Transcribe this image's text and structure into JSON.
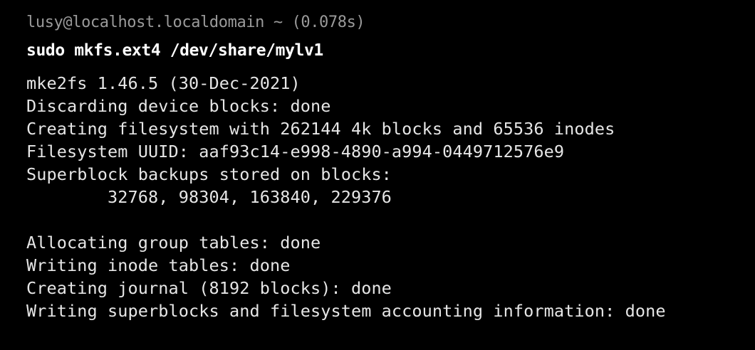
{
  "prompt": {
    "text": "lusy@localhost.localdomain ~ (0.078s)"
  },
  "command": {
    "text": "sudo mkfs.ext4 /dev/share/mylv1"
  },
  "output": {
    "lines": [
      "mke2fs 1.46.5 (30-Dec-2021)",
      "Discarding device blocks: done",
      "Creating filesystem with 262144 4k blocks and 65536 inodes",
      "Filesystem UUID: aaf93c14-e998-4890-a994-0449712576e9",
      "Superblock backups stored on blocks:",
      "        32768, 98304, 163840, 229376",
      "",
      "Allocating group tables: done",
      "Writing inode tables: done",
      "Creating journal (8192 blocks): done",
      "Writing superblocks and filesystem accounting information: done"
    ]
  },
  "colors": {
    "background": "#000000",
    "prompt": "#9a9a9a",
    "command": "#ffffff",
    "output": "#e6e6e6"
  }
}
